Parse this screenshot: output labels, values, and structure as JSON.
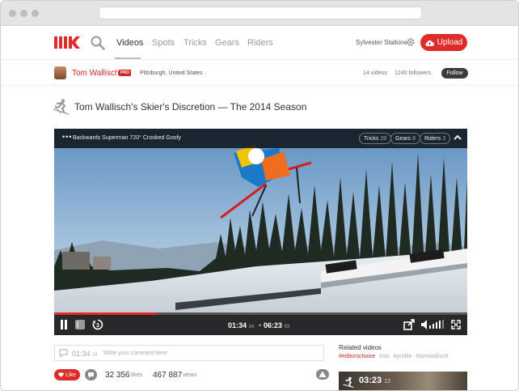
{
  "nav": {
    "items": [
      "Videos",
      "Spots",
      "Tricks",
      "Gears",
      "Riders"
    ],
    "active": "Videos",
    "user": "Sylvester Stallone",
    "upload_label": "Upload",
    "brand_color": "#e02b2b"
  },
  "profile": {
    "name": "Tom Wallisch",
    "badge": "PRO",
    "location": "Pittsburgh, United States",
    "videos": "14 videos",
    "followers": "1240 followers",
    "follow_label": "Follow"
  },
  "video": {
    "title": "Tom Wallisch's Skier's Discretion — The 2014 Season",
    "trick_title": "Backwards Superman 720° Crooked Goofy",
    "pills": [
      {
        "label": "Tricks",
        "count": "28"
      },
      {
        "label": "Gears",
        "count": "8"
      },
      {
        "label": "Riders",
        "count": "3"
      }
    ],
    "current_time": "01:34",
    "current_ms": "34",
    "duration": "06:23",
    "duration_ms": "93",
    "progress": 0.248
  },
  "comment": {
    "time": "01:34",
    "time_ms": "34",
    "placeholder": "Write your comment here"
  },
  "stats": {
    "like_label": "Like",
    "likes": "32 356",
    "likes_label": "likes",
    "views": "467 887",
    "views_label": "views"
  },
  "related": {
    "title": "Related videos",
    "tags": [
      "#editorschoice",
      "#ski",
      "#profile",
      "#tomwallisch"
    ],
    "first_time": "03:23",
    "first_ms": "12"
  }
}
